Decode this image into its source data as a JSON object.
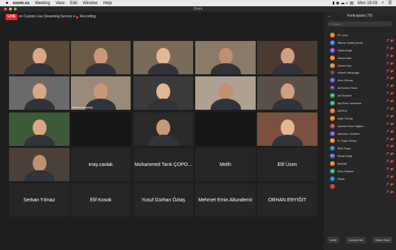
{
  "menubar": {
    "app": "zoom.us",
    "items": [
      "Meeting",
      "View",
      "Edit",
      "Window",
      "Help"
    ],
    "clock": "Mon 15:03"
  },
  "window": {
    "title": "Zoom"
  },
  "toolbar": {
    "live": "LIVE",
    "stream": "on Custom Live Streaming Service",
    "recording": "Recording"
  },
  "gallery": {
    "video_tiles": [
      {
        "label": ""
      },
      {
        "label": ""
      },
      {
        "label": ""
      },
      {
        "label": ""
      },
      {
        "label": ""
      },
      {
        "label": ""
      },
      {
        "label": "Semra Kurt Jorbalj"
      },
      {
        "label": ""
      },
      {
        "label": ""
      },
      {
        "label": ""
      },
      {
        "label": ""
      },
      {
        "label": ""
      },
      {
        "label": ""
      },
      {
        "label": ""
      },
      {
        "label": ""
      },
      {
        "label": ""
      }
    ],
    "name_tiles": [
      "eray.cavlak",
      "Muhammed Tarık ÇOPO...",
      "Melih",
      "Elif Üzen",
      "Serkan Yılmaz",
      "Elif Kosok",
      "Yusuf Gürhan Öztaş",
      "Mehmet Emin Altundemir",
      "ORHAN ERYİĞİT"
    ]
  },
  "participants": {
    "title": "Participants (75)",
    "search_placeholder": "Search",
    "list": [
      {
        "name": "EY (me)",
        "color": "#e8822a",
        "initials": "E"
      },
      {
        "name": "Billurin Vedial (Host)",
        "color": "#4a7bd0",
        "initials": "B"
      },
      {
        "name": "Rabia Ergin",
        "color": "#8f5ac8",
        "initials": "R"
      },
      {
        "name": "Ahmet Atar",
        "color": "#e8822a",
        "initials": "AA"
      },
      {
        "name": "Ahmet Sarı",
        "color": "#e8822a",
        "initials": "AS"
      },
      {
        "name": "Ahmet Yakupoğlu",
        "color": "#444444",
        "initials": "A"
      },
      {
        "name": "Akın Gürsoy",
        "color": "#6a5ac8",
        "initials": "AG"
      },
      {
        "name": "Ali Kerem Fidan",
        "color": "#4a4a7a",
        "initials": "AK"
      },
      {
        "name": "Ali Sönmez",
        "color": "#3aa06a",
        "initials": "AS"
      },
      {
        "name": "Alp Eren Yurtseven",
        "color": "#3aa06a",
        "initials": "AE"
      },
      {
        "name": "ARTEG",
        "color": "#e8822a",
        "initials": "A"
      },
      {
        "name": "Aylin Tümay",
        "color": "#e8822a",
        "initials": "AT"
      },
      {
        "name": "Aylemir İlhan Sağlam",
        "color": "#c04a4a",
        "initials": "A"
      },
      {
        "name": "Aysemur Sonmez",
        "color": "#6a5ac8",
        "initials": "AS"
      },
      {
        "name": "B. Doğa Günay",
        "color": "#e8822a",
        "initials": "BD"
      },
      {
        "name": "Bilal Topçu",
        "color": "#2a80c8",
        "initials": "B"
      },
      {
        "name": "Burak Hatip",
        "color": "#6a5ac8",
        "initials": "BH"
      },
      {
        "name": "Buncak",
        "color": "#e8822a",
        "initials": "B"
      },
      {
        "name": "Ebru Zeybek",
        "color": "#3aa06a",
        "initials": "EZ"
      },
      {
        "name": "Esem",
        "color": "#2a80c8",
        "initials": "E"
      },
      {
        "name": "",
        "color": "#c04a4a",
        "initials": ""
      }
    ],
    "footer": {
      "invite": "Invite",
      "unmute": "Unmute Me",
      "raise": "Raise Hand"
    }
  }
}
